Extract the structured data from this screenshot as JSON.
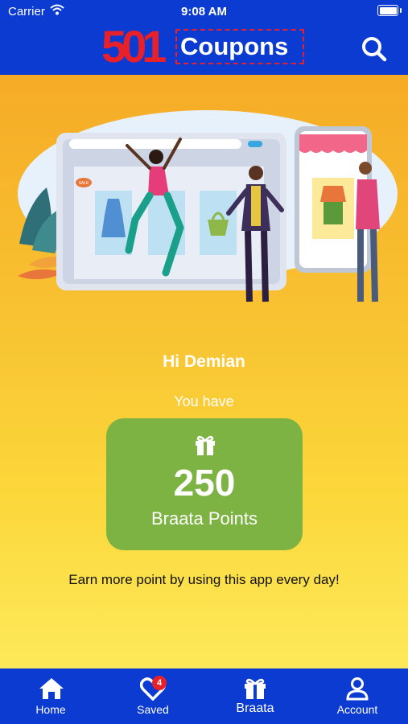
{
  "status_bar": {
    "carrier": "Carrier",
    "time": "9:08 AM"
  },
  "header": {
    "logo_number": "501",
    "logo_word": "Coupons"
  },
  "illustration": {
    "sale_tag": "SALE"
  },
  "main": {
    "greeting": "Hi Demian",
    "you_have": "You have",
    "points_value": "250",
    "points_label": "Braata Points",
    "earn_text": "Earn more point by using this app every day!"
  },
  "tabbar": {
    "tabs": [
      {
        "label": "Home",
        "icon": "home-icon"
      },
      {
        "label": "Saved",
        "icon": "heart-icon",
        "badge": "4"
      },
      {
        "label": "Braata",
        "icon": "gift-icon"
      },
      {
        "label": "Account",
        "icon": "user-icon"
      }
    ]
  },
  "colors": {
    "header": "#0b3bd0",
    "accent_red": "#e8202a",
    "card_green": "#7db342",
    "background_top": "#f6ab26",
    "background_bottom": "#fde95a"
  }
}
